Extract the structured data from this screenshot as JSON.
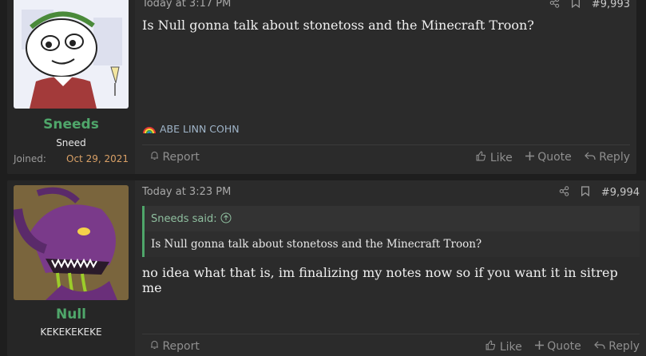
{
  "posts": [
    {
      "author": "Sneeds",
      "user_title": "Sneed",
      "joined_label": "Joined:",
      "joined_date": "Oct 29, 2021",
      "time": "Today at 3:17 PM",
      "number": "#9,993",
      "body": "Is Null gonna talk about stonetoss and the Minecraft Troon?",
      "signature": "ABE LINN COHN",
      "report": "Report",
      "like": "Like",
      "quote": "Quote",
      "reply": "Reply"
    },
    {
      "author": "Null",
      "user_title": "KEKEKEKEKE",
      "time": "Today at 3:23 PM",
      "number": "#9,994",
      "quote_head": "Sneeds said:",
      "quote_body": "Is Null gonna talk about stonetoss and the Minecraft Troon?",
      "body": "no idea what that is, im finalizing my notes now so if you want it in sitrep me",
      "report": "Report",
      "like": "Like",
      "quote": "Quote",
      "reply": "Reply"
    }
  ],
  "icons": {
    "share": "share-icon",
    "bookmark": "bookmark-icon",
    "bell": "bell-icon",
    "thumb": "thumbs-up-icon",
    "plus": "plus-icon",
    "reply": "reply-arrow-icon",
    "rainbow": "rainbow-emoji",
    "arrow_up": "arrow-up-circle-icon"
  },
  "colors": {
    "username": "#4fa66a",
    "joined_date": "#d9a066",
    "quote_bar": "#4fa66a"
  }
}
